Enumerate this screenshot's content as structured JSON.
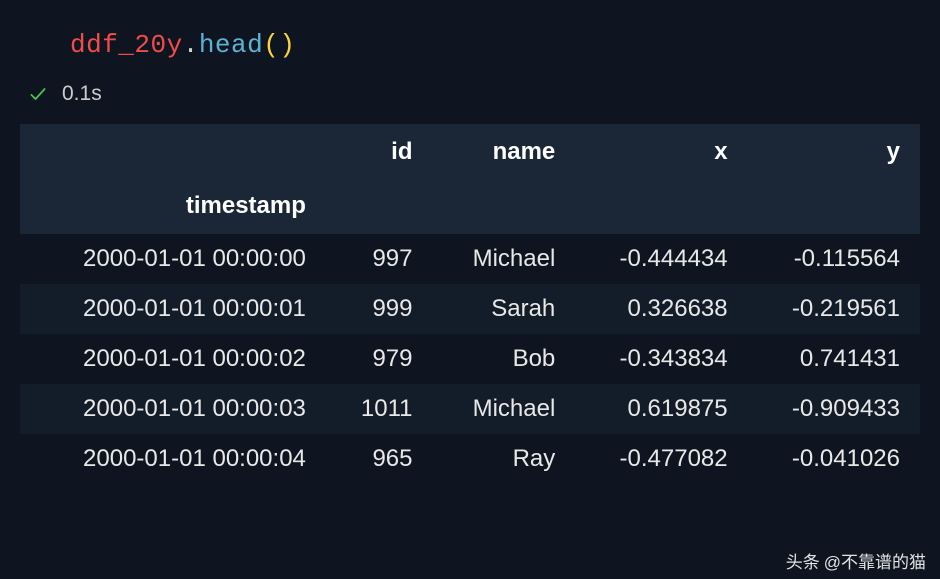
{
  "code": {
    "variable": "ddf_20y",
    "dot": ".",
    "func": "head",
    "openParen": "(",
    "closeParen": ")"
  },
  "status": {
    "duration": "0.1s"
  },
  "table": {
    "columns": [
      "id",
      "name",
      "x",
      "y"
    ],
    "indexName": "timestamp",
    "rows": [
      {
        "index": "2000-01-01 00:00:00",
        "id": "997",
        "name": "Michael",
        "x": "-0.444434",
        "y": "-0.115564"
      },
      {
        "index": "2000-01-01 00:00:01",
        "id": "999",
        "name": "Sarah",
        "x": "0.326638",
        "y": "-0.219561"
      },
      {
        "index": "2000-01-01 00:00:02",
        "id": "979",
        "name": "Bob",
        "x": "-0.343834",
        "y": "0.741431"
      },
      {
        "index": "2000-01-01 00:00:03",
        "id": "1011",
        "name": "Michael",
        "x": "0.619875",
        "y": "-0.909433"
      },
      {
        "index": "2000-01-01 00:00:04",
        "id": "965",
        "name": "Ray",
        "x": "-0.477082",
        "y": "-0.041026"
      }
    ]
  },
  "watermark": {
    "prefix": "头条",
    "user": "@不靠谱的猫"
  }
}
